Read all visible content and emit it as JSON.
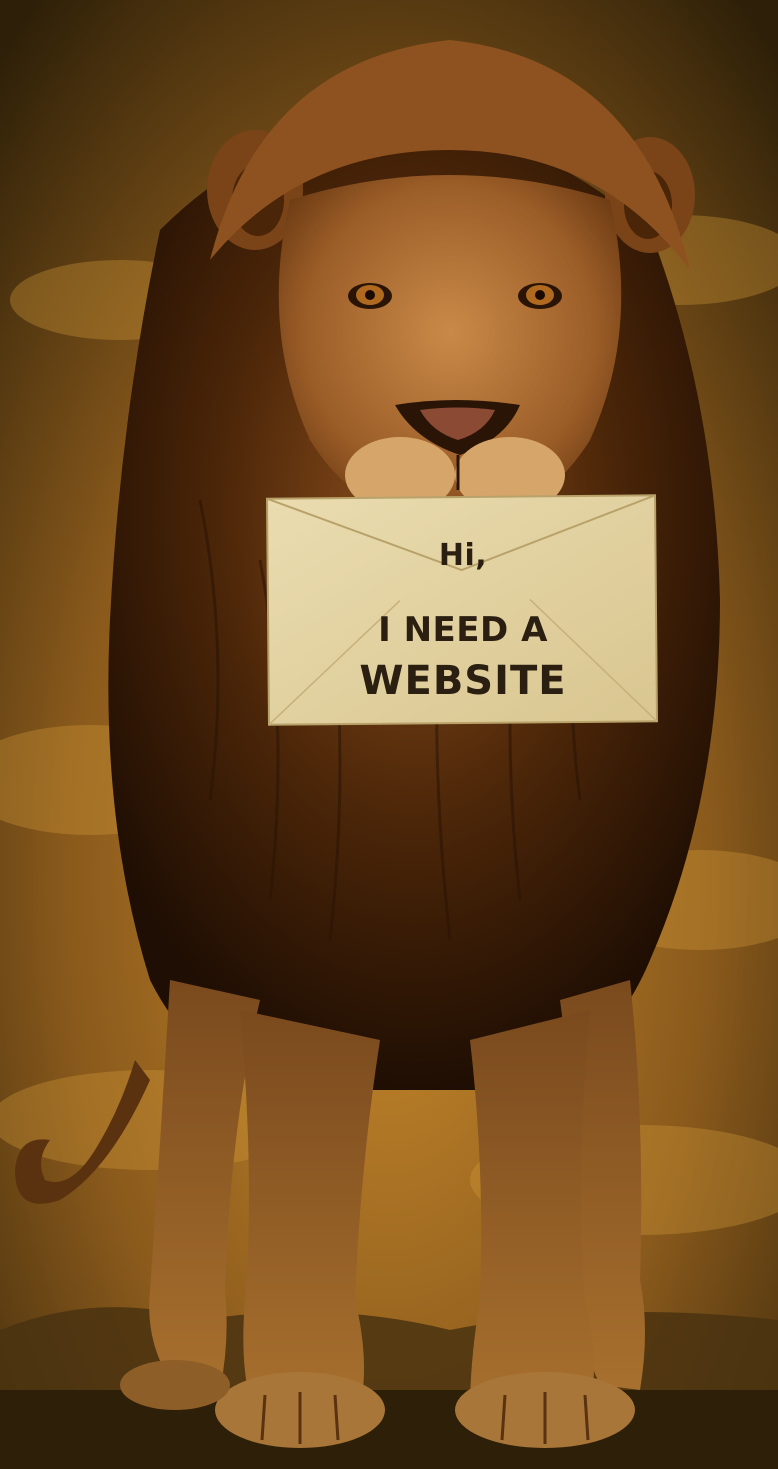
{
  "envelope": {
    "line1": "Hi,",
    "line2": "I NEED A",
    "line3": "WEBSITE"
  },
  "palette": {
    "sky_light": "#c98a2c",
    "sky_dark": "#3a2508",
    "mane_dark": "#2a1405",
    "fur": "#a8652a",
    "paper": "#e6d6a8",
    "ink": "#2a1f10"
  }
}
